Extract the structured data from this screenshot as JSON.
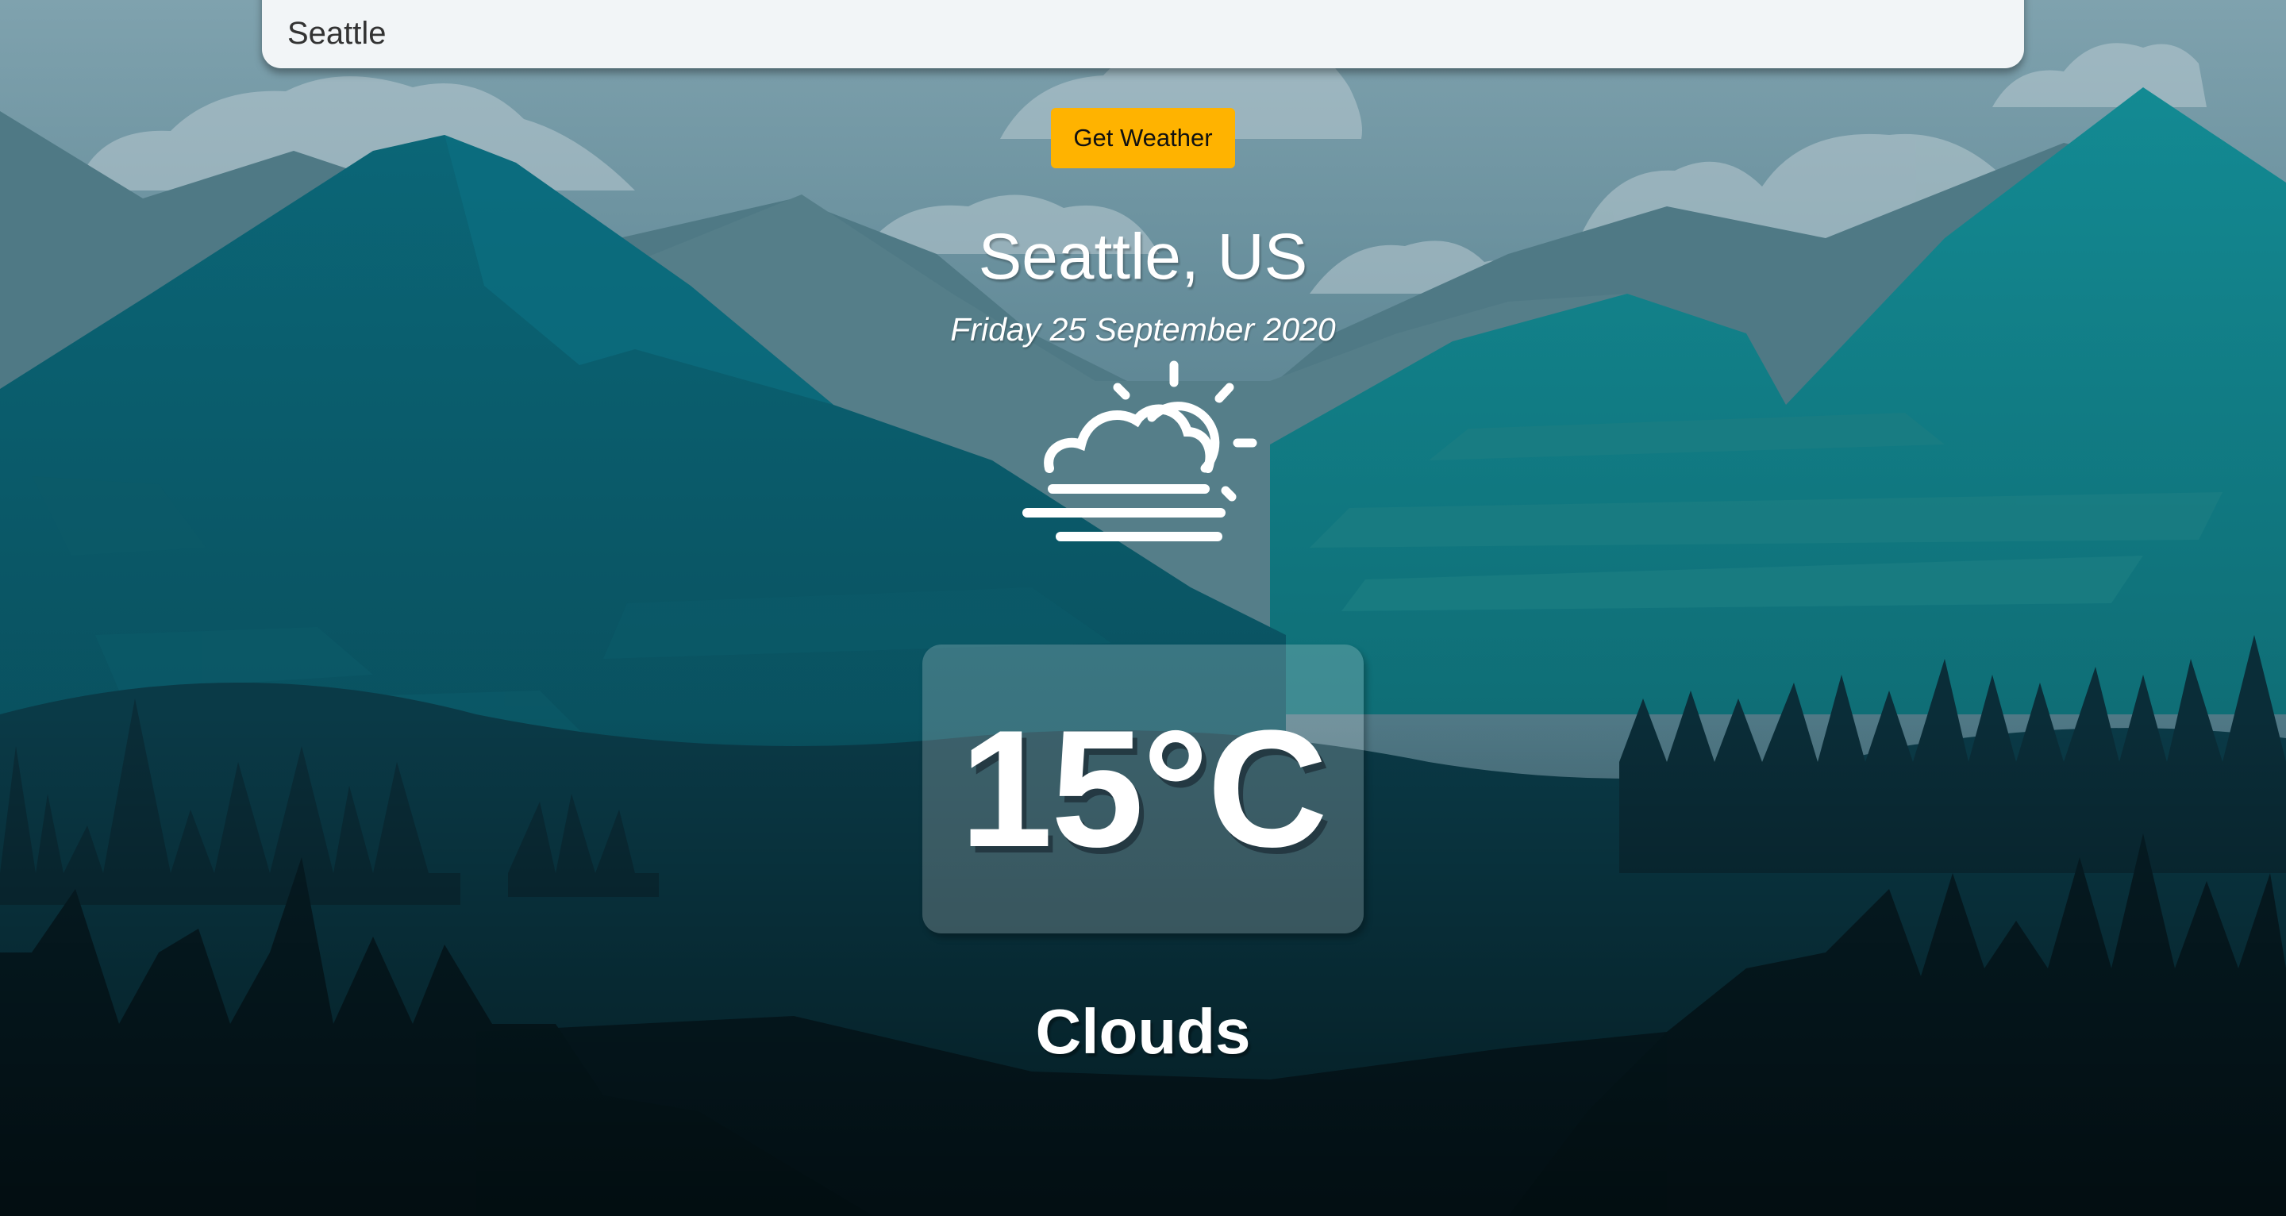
{
  "search": {
    "value": "Seattle"
  },
  "actions": {
    "get_weather_label": "Get Weather"
  },
  "weather": {
    "location": "Seattle, US",
    "date": "Friday 25 September 2020",
    "temperature": "15°C",
    "condition": "Clouds",
    "icon": "partly-cloudy-sun-icon"
  },
  "colors": {
    "button_accent": "#ffb300",
    "sky_top": "#7d9fac",
    "forest_dark": "#05141a"
  }
}
